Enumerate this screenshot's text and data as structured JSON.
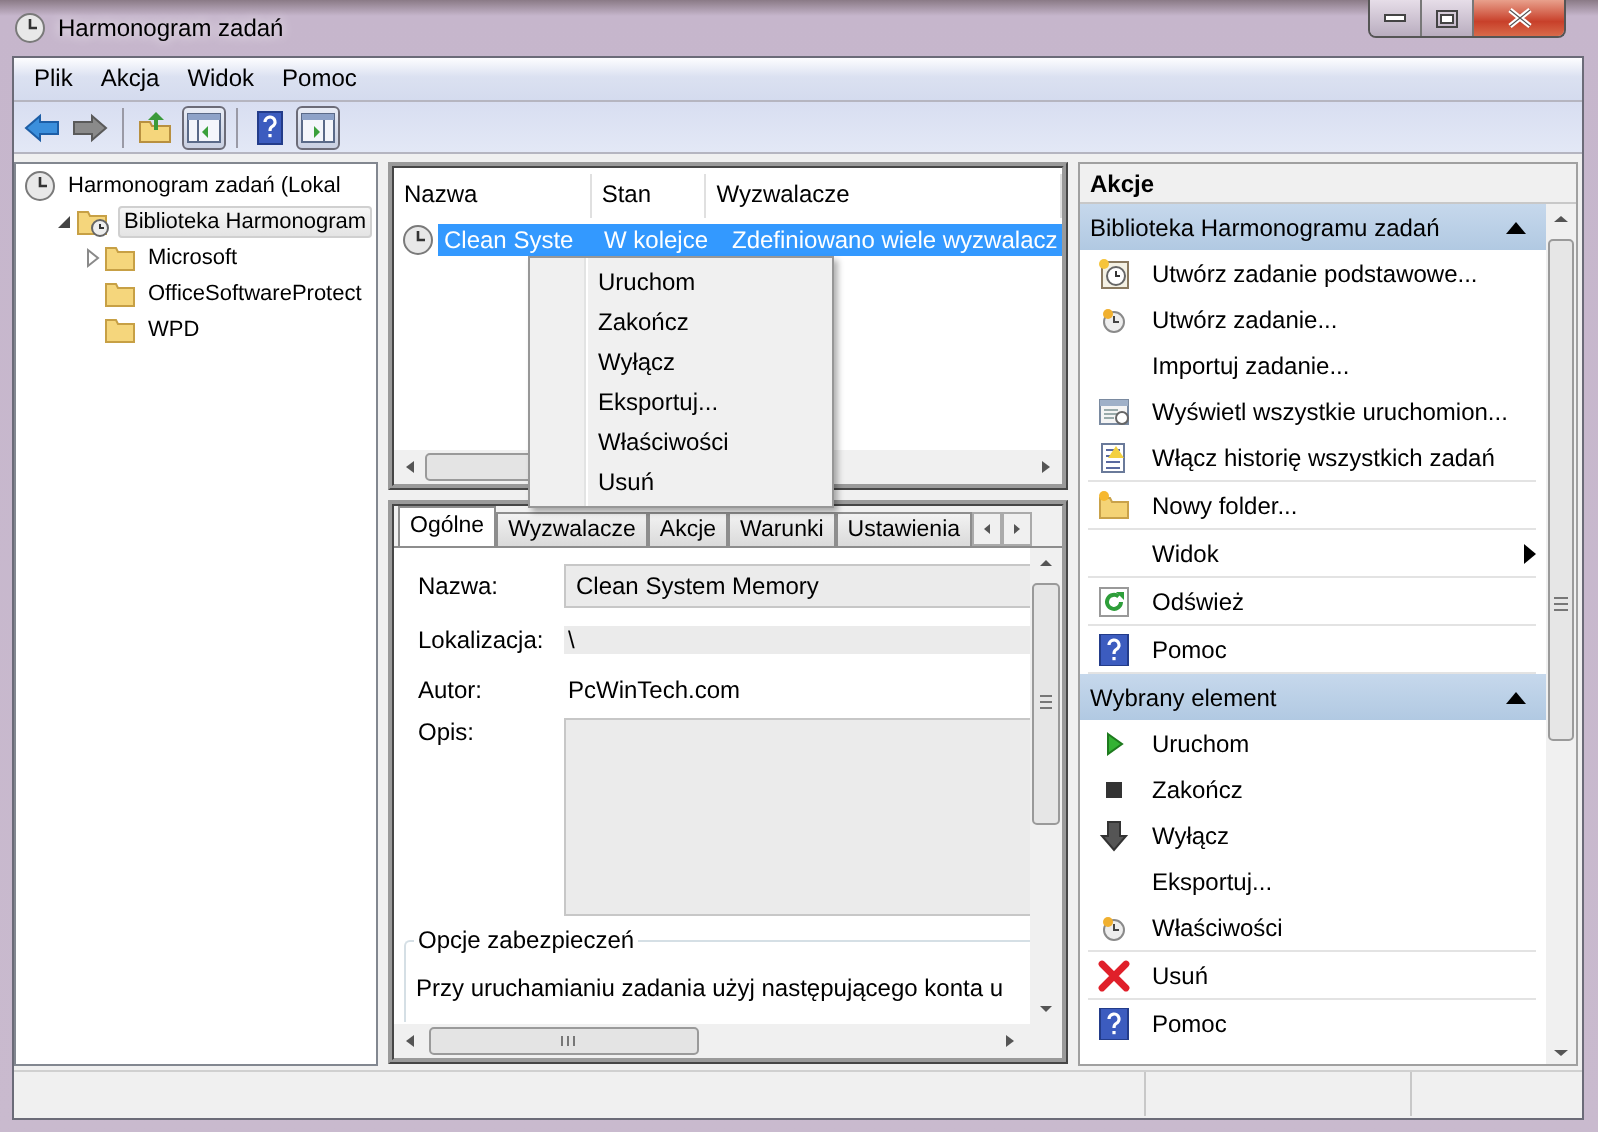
{
  "window": {
    "title": "Harmonogram zadań"
  },
  "menu": [
    {
      "label": "Plik"
    },
    {
      "label": "Akcja"
    },
    {
      "label": "Widok"
    },
    {
      "label": "Pomoc"
    }
  ],
  "toolbar": [
    {
      "pressed": false
    },
    {
      "pressed": false
    },
    {
      "pressed": false
    },
    {
      "pressed": true
    },
    {
      "pressed": false
    },
    {
      "pressed": true
    }
  ],
  "tree": [
    {
      "label": "Harmonogram zadań (Lokal",
      "selected": false,
      "children": [
        {
          "label": "Biblioteka Harmonogram",
          "selected": true,
          "expanded": true,
          "children": [
            {
              "label": "Microsoft",
              "selected": false,
              "expanded": false
            },
            {
              "label": "OfficeSoftwareProtect",
              "selected": false
            },
            {
              "label": "WPD",
              "selected": false
            }
          ]
        }
      ]
    }
  ],
  "task_list": {
    "columns": [
      "Nazwa",
      "Stan",
      "Wyzwalacze"
    ],
    "rows": [
      {
        "cells": [
          "Clean Syste",
          "W kolejce",
          "Zdefiniowano wiele wyzwalacz"
        ],
        "selected": true
      }
    ]
  },
  "context_menu": {
    "items": [
      "Uruchom",
      "Zakończ",
      "Wyłącz",
      "Eksportuj...",
      "Właściwości",
      "Usuń"
    ]
  },
  "details": {
    "tabs": [
      {
        "label": "Ogólne",
        "selected": true
      },
      {
        "label": "Wyzwalacze",
        "selected": false
      },
      {
        "label": "Akcje",
        "selected": false
      },
      {
        "label": "Warunki",
        "selected": false
      },
      {
        "label": "Ustawienia",
        "selected": false
      }
    ],
    "fields": [
      {
        "label": "Nazwa:",
        "value": "Clean System Memory",
        "kind": "field"
      },
      {
        "label": "Lokalizacja:",
        "value": "\\",
        "kind": "readonly"
      },
      {
        "label": "Autor:",
        "value": "PcWinTech.com",
        "kind": "text"
      },
      {
        "label": "Opis:",
        "kind": "area"
      }
    ],
    "security": {
      "title": "Opcje zabezpieczeń",
      "text": "Przy uruchamianiu zadania użyj następującego konta u"
    }
  },
  "actions": {
    "title": "Akcje",
    "sections": [
      {
        "title": "Biblioteka Harmonogramu zadań",
        "expanded": true,
        "groups": [
          [
            {
              "label": "Utwórz zadanie podstawowe..."
            },
            {
              "label": "Utwórz zadanie..."
            },
            {
              "label": "Importuj zadanie..."
            },
            {
              "label": "Wyświetl wszystkie uruchomion..."
            },
            {
              "label": "Włącz historię wszystkich zadań"
            }
          ],
          [
            {
              "label": "Nowy folder..."
            }
          ],
          [
            {
              "label": "Widok",
              "submenu": true
            }
          ],
          [
            {
              "label": "Odśwież"
            }
          ],
          [
            {
              "label": "Pomoc"
            }
          ]
        ]
      },
      {
        "title": "Wybrany element",
        "expanded": true,
        "groups": [
          [
            {
              "label": "Uruchom"
            },
            {
              "label": "Zakończ"
            },
            {
              "label": "Wyłącz"
            },
            {
              "label": "Eksportuj..."
            },
            {
              "label": "Właściwości"
            }
          ],
          [
            {
              "label": "Usuń"
            }
          ],
          [
            {
              "label": "Pomoc"
            }
          ]
        ]
      }
    ]
  }
}
